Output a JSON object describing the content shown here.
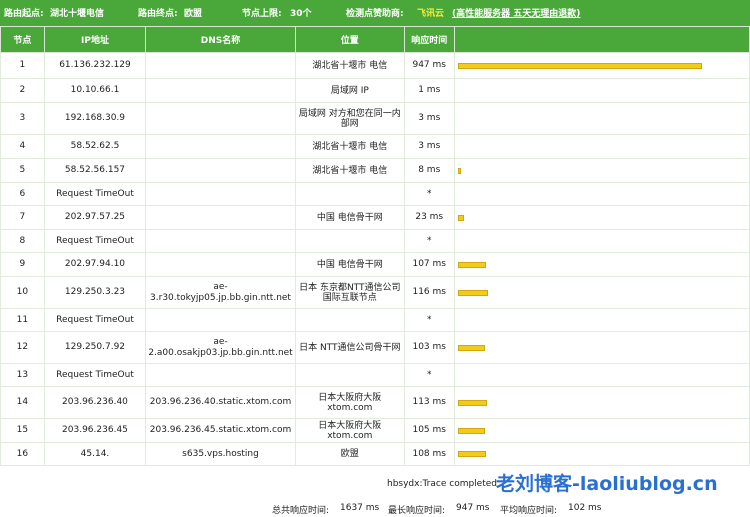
{
  "header": {
    "start_label": "路由起点:",
    "start_value": "湖北十堰电信",
    "end_label": "路由终点:",
    "end_value": "欧盟",
    "limit_label": "节点上限:",
    "limit_value": "30个",
    "sponsor_label": "检测点赞助商:",
    "sponsor_name": "飞讯云",
    "sponsor_slogan": "(高性能服务器 五天无理由退款)"
  },
  "table": {
    "columns": [
      "节点",
      "IP地址",
      "DNS名称",
      "位置",
      "响应时间",
      ""
    ],
    "rows": [
      {
        "hop": "1",
        "ip": "61.136.232.129",
        "dns": "",
        "loc": "湖北省十堰市 电信",
        "time": "947 ms",
        "bar": 1.0
      },
      {
        "hop": "2",
        "ip": "10.10.66.1",
        "dns": "",
        "loc": "局域网 IP",
        "time": "1 ms",
        "bar": 0
      },
      {
        "hop": "3",
        "ip": "192.168.30.9",
        "dns": "",
        "loc": "局域网 对方和您在同一内部网",
        "time": "3 ms",
        "bar": 0
      },
      {
        "hop": "4",
        "ip": "58.52.62.5",
        "dns": "",
        "loc": "湖北省十堰市 电信",
        "time": "3 ms",
        "bar": 0
      },
      {
        "hop": "5",
        "ip": "58.52.56.157",
        "dns": "",
        "loc": "湖北省十堰市 电信",
        "time": "8 ms",
        "bar": 0.01
      },
      {
        "hop": "6",
        "ip": "Request TimeOut",
        "dns": "",
        "loc": "",
        "time": "*",
        "bar": 0
      },
      {
        "hop": "7",
        "ip": "202.97.57.25",
        "dns": "",
        "loc": "中国 电信骨干网",
        "time": "23 ms",
        "bar": 0.025
      },
      {
        "hop": "8",
        "ip": "Request TimeOut",
        "dns": "",
        "loc": "",
        "time": "*",
        "bar": 0
      },
      {
        "hop": "9",
        "ip": "202.97.94.10",
        "dns": "",
        "loc": "中国 电信骨干网",
        "time": "107 ms",
        "bar": 0.113
      },
      {
        "hop": "10",
        "ip": "129.250.3.23",
        "dns": "ae-3.r30.tokyjp05.jp.bb.gin.ntt.net",
        "loc": "日本 东京都NTT通信公司国际互联节点",
        "time": "116 ms",
        "bar": 0.122
      },
      {
        "hop": "11",
        "ip": "Request TimeOut",
        "dns": "",
        "loc": "",
        "time": "*",
        "bar": 0
      },
      {
        "hop": "12",
        "ip": "129.250.7.92",
        "dns": "ae-2.a00.osakjp03.jp.bb.gin.ntt.net",
        "loc": "日本 NTT通信公司骨干网",
        "time": "103 ms",
        "bar": 0.109
      },
      {
        "hop": "13",
        "ip": "Request TimeOut",
        "dns": "",
        "loc": "",
        "time": "*",
        "bar": 0
      },
      {
        "hop": "14",
        "ip": "203.96.236.40",
        "dns": "203.96.236.40.static.xtom.com",
        "loc": "日本大阪府大阪 xtom.com",
        "time": "113 ms",
        "bar": 0.119
      },
      {
        "hop": "15",
        "ip": "203.96.236.45",
        "dns": "203.96.236.45.static.xtom.com",
        "loc": "日本大阪府大阪 xtom.com",
        "time": "105 ms",
        "bar": 0.111
      },
      {
        "hop": "16",
        "ip": "45.14.",
        "dns": "s635.vps.hosting",
        "loc": "欧盟",
        "time": "108 ms",
        "bar": 0.114
      }
    ]
  },
  "status": "hbsydx:Trace completed",
  "watermark": "老刘博客-laoliublog.cn",
  "summary": {
    "total_label": "总共响应时间:",
    "total_value": "1637 ms",
    "max_label": "最长响应时间:",
    "max_value": "947 ms",
    "avg_label": "平均响应时间:",
    "avg_value": "102 ms"
  },
  "colors": {
    "header_bg": "#4aa83a",
    "bar": "#f3cb1b",
    "watermark": "#2a6fd2"
  }
}
